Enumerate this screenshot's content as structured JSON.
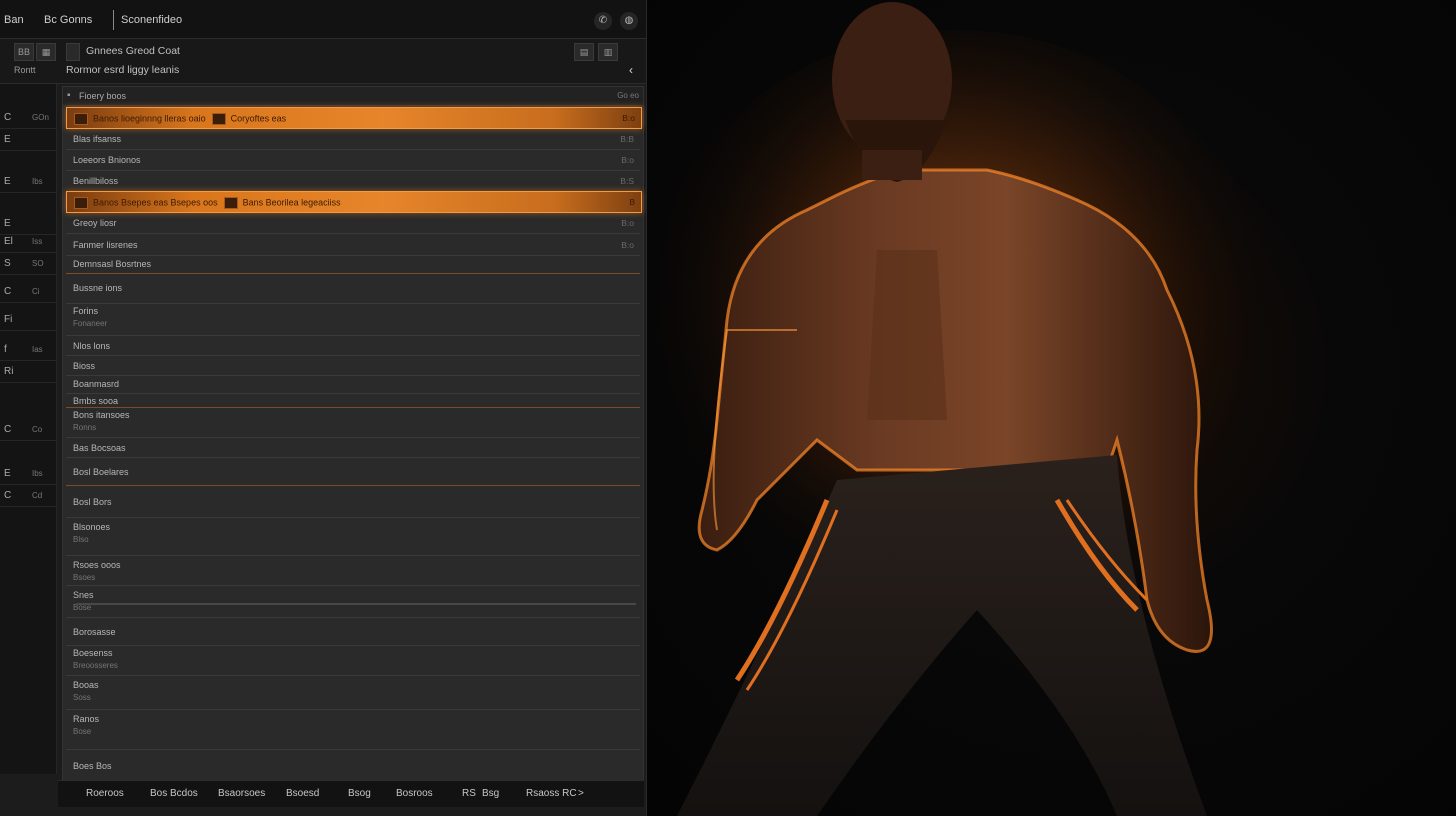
{
  "titlebar": {
    "tabs": [
      "Ban",
      "Bc Gonns",
      "Sconenfideo"
    ],
    "icons": [
      "phone-icon",
      "globe-icon"
    ]
  },
  "toolbar": {
    "left_icon_1": "BB",
    "left_icon_2": "Rontt",
    "title": "Gnnees Greod Coat",
    "subtitle": "Rormor esrd liggy leanis",
    "collapse_icon": "chevron-left-icon"
  },
  "sidebar": {
    "items": [
      {
        "a": "C",
        "b": "GOn"
      },
      {
        "a": "E",
        "b": ""
      },
      {
        "a": "E",
        "b": "Ibs"
      },
      {
        "a": "E",
        "b": ""
      },
      {
        "a": "El",
        "b": "Iss"
      },
      {
        "a": "S",
        "b": "SO"
      },
      {
        "a": "C",
        "b": "Ci"
      },
      {
        "a": "Fi",
        "b": ""
      },
      {
        "a": "f",
        "b": "Ias"
      },
      {
        "a": "Ri",
        "b": ""
      },
      {
        "a": "C",
        "b": "Co"
      },
      {
        "a": "E",
        "b": "Ibs"
      },
      {
        "a": "C",
        "b": "Cd"
      }
    ]
  },
  "panel": {
    "header": "Fioery boos",
    "header_value": "Go eo",
    "rows": [
      {
        "label": "Banos lioeginnng lleras oaio",
        "label2": "Coryoftes eas",
        "value": "B:o",
        "highlight": true
      },
      {
        "label": "Blas ifsanss",
        "value": "B:B"
      },
      {
        "label": "Loeeors Bnionos",
        "value": "B:o"
      },
      {
        "label": "Benillbiloss",
        "value": "B:S"
      },
      {
        "label": "Banos Bsepes eas Bsepes oos",
        "label2": "Bans Beorilea legeaciiss",
        "value": "B",
        "highlight": true
      },
      {
        "label": "Greoy liosr",
        "value": "B:o"
      },
      {
        "label": "Fanmer lisrenes",
        "value": "B:o"
      },
      {
        "label": "Demnsasl Bosrtnes",
        "value": ""
      },
      {
        "label": "Bussne ions",
        "value": ""
      },
      {
        "label": "Forins",
        "sub": "Fonaneer",
        "value": ""
      },
      {
        "label": "Nlos lons",
        "value": ""
      },
      {
        "label": "Bioss",
        "value": ""
      },
      {
        "label": "Boanmasrd",
        "value": ""
      },
      {
        "label": "Bmbs sooa",
        "value": ""
      },
      {
        "label": "Bons itansoes",
        "sub": "Ronns",
        "value": ""
      },
      {
        "label": "Bas Bocsoas",
        "value": ""
      },
      {
        "label": "Bosl Boelares",
        "value": ""
      },
      {
        "label": "Bosl Bors",
        "value": ""
      },
      {
        "label": "Blsonoes",
        "sub": "Blso",
        "value": ""
      },
      {
        "label": "Rsoes ooos",
        "sub": "Bsoes",
        "value": ""
      },
      {
        "label": "Snes",
        "sub": "Bose",
        "value": ""
      },
      {
        "label": "Borosasse",
        "value": ""
      },
      {
        "label": "Boesenss",
        "sub": "Breoosseres",
        "value": ""
      },
      {
        "label": "Booas",
        "sub": "Soss",
        "value": ""
      },
      {
        "label": "Ranos",
        "sub": "Bose",
        "value": ""
      },
      {
        "label": "Boes Bos",
        "value": ""
      }
    ]
  },
  "bottom": {
    "items": [
      "Roeroos",
      "Bos Bcdos",
      "Bsaorsoes",
      "Bsoesd",
      "Bsog",
      "Bosroos",
      "RS",
      "Bsg",
      "Rsaoss RC"
    ],
    "arrow": ">"
  },
  "accent_color": "#e8842a"
}
